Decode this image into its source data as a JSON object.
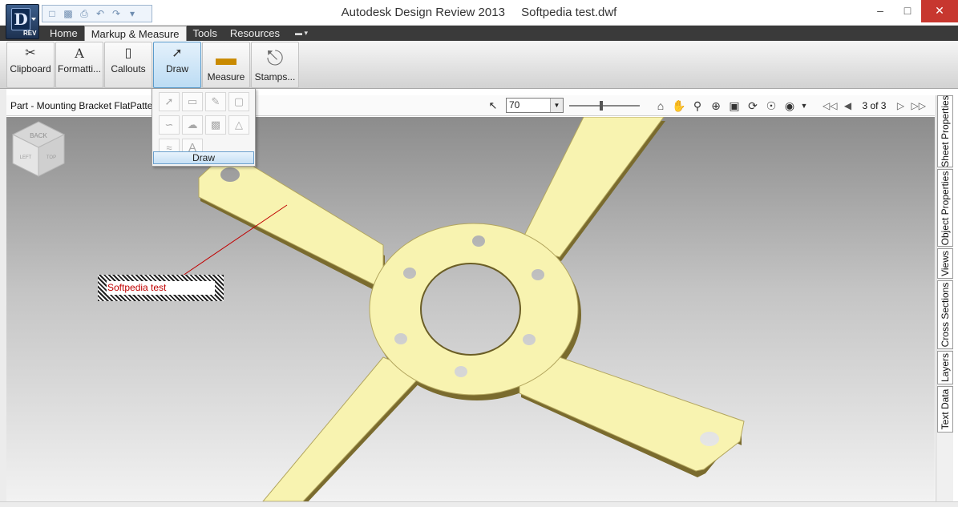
{
  "window": {
    "app_title": "Autodesk Design Review 2013",
    "doc_title": "Softpedia test.dwf",
    "app_button_label": "REV",
    "minimize": "–",
    "maximize": "□",
    "close": "✕"
  },
  "quick_access": {
    "icons": [
      "open-icon",
      "save-icon",
      "print-icon",
      "undo-icon",
      "redo-icon",
      "customize-icon"
    ]
  },
  "tabs": [
    {
      "label": "Home",
      "active": false
    },
    {
      "label": "Markup & Measure",
      "active": true
    },
    {
      "label": "Tools",
      "active": false
    },
    {
      "label": "Resources",
      "active": false
    }
  ],
  "ribbon": {
    "clipboard": "Clipboard",
    "formatting": "Formatti...",
    "callouts": "Callouts",
    "draw": "Draw",
    "measure": "Measure",
    "stamps": "Stamps..."
  },
  "draw_panel": {
    "footer": "Draw",
    "tools": [
      "line-tool",
      "rectangle-tool",
      "pen-tool",
      "rounded-rect-tool",
      "polyline-tool",
      "cloud-tool",
      "shape-tool",
      "polygon-cloud-tool",
      "spring-tool",
      "text-tool"
    ]
  },
  "navbar": {
    "document_name": "Part - Mounting Bracket FlatPattern",
    "zoom_value": "70",
    "zoom_level": 0.45,
    "page_counter": "3 of 3"
  },
  "canvas": {
    "markup_text": "Softpedia test",
    "viewcube": {
      "top": "BACK",
      "front": "LEFT",
      "bottom": "TOP"
    }
  },
  "side_tabs": [
    "Sheet Properties",
    "Object Properties",
    "Views",
    "Cross Sections",
    "Layers",
    "Text Data"
  ],
  "colors": {
    "part_fill": "#f8f3b0",
    "part_edge": "#8a7a3c",
    "markup_line": "#c00000",
    "title_close": "#c7372f",
    "tab_bar": "#3a3a3a"
  }
}
